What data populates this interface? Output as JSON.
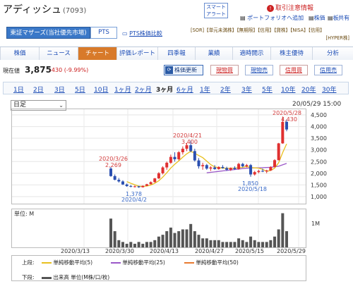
{
  "header": {
    "name": "アディッシュ",
    "code": "(7093)",
    "alert_line1": "スマート",
    "alert_line2": "アラート",
    "sell_note": "取引注意情報",
    "portfolio_add": "ポートフォリオへ追加",
    "stock_price": "株価",
    "board": "板",
    "share": "共有",
    "market": "東証マザーズ(当社優先市場)",
    "pts": "PTS",
    "pts_compare": "PTS株価比較",
    "badges_line1": "[SOR]【単元未満株】【無期限】【信用】【貸株】【NISA】【信用】",
    "badges_line2": "[HYPER株]"
  },
  "tabs": [
    {
      "label": "株価"
    },
    {
      "label": "ニュース"
    },
    {
      "label": "チャート"
    },
    {
      "label": "評価レポート"
    },
    {
      "label": "四季報"
    },
    {
      "label": "業績"
    },
    {
      "label": "適時開示"
    },
    {
      "label": "株主優待"
    },
    {
      "label": "分析"
    }
  ],
  "quote": {
    "label": "現在値",
    "price": "3,875",
    "change": "-430 (-9.99%)",
    "update": "株価更新",
    "buy_spot": "現物買",
    "sell_spot": "現物売",
    "buy_margin": "信用買",
    "sell_margin": "信用売"
  },
  "ranges": [
    "1日",
    "2日",
    "3日",
    "5日",
    "10日",
    "1ヶ月",
    "2ヶ月",
    "3ヶ月",
    "6ヶ月",
    "1年",
    "2年",
    "3年",
    "5年",
    "10年",
    "20年",
    "30年"
  ],
  "selected_range": "3ヶ月",
  "period": {
    "value": "日足"
  },
  "timestamp": "20/05/29 15:00",
  "y_ticks": [
    "4,500",
    "4,000",
    "3,500",
    "3,000",
    "2,500",
    "2,000",
    "1,500",
    "1,000"
  ],
  "volume": {
    "unit": "単位: M",
    "tick": "1M"
  },
  "x_ticks": [
    "2020/3/13",
    "2020/3/30",
    "2020/4/13",
    "2020/4/27",
    "2020/5/15",
    "2020/5/29"
  ],
  "annotations": {
    "a1_date": "2020/3/26",
    "a1_val": "2,269",
    "a2_date": "2020/4/21",
    "a2_val": "3,400",
    "a3_date": "2020/5/28",
    "a3_val": "4,430",
    "b1_val": "1,378",
    "b1_date": "2020/4/2",
    "b2_val": "1,850",
    "b2_date": "2020/5/18"
  },
  "legend": {
    "upper": "上段:",
    "ma5": "単純移動平均(5)",
    "ma25": "単純移動平均(25)",
    "ma50": "単純移動平均(50)",
    "lower": "下段:",
    "vol": "出来高 単位(M株/口/枚)",
    "ma5_color": "#e8c020",
    "ma25_color": "#9b58c8",
    "ma50_color": "#e87a30",
    "vol_color": "#555555"
  },
  "chart_data": [
    {
      "type": "candlestick",
      "ylim": [
        1000,
        4500
      ],
      "x": [
        "2020/3/24",
        "2020/3/25",
        "2020/3/26",
        "2020/3/27",
        "2020/3/30",
        "2020/3/31",
        "2020/4/1",
        "2020/4/2",
        "2020/4/3",
        "2020/4/6",
        "2020/4/7",
        "2020/4/8",
        "2020/4/9",
        "2020/4/10",
        "2020/4/13",
        "2020/4/14",
        "2020/4/15",
        "2020/4/16",
        "2020/4/17",
        "2020/4/20",
        "2020/4/21",
        "2020/4/22",
        "2020/4/23",
        "2020/4/24",
        "2020/4/27",
        "2020/4/28",
        "2020/4/30",
        "2020/5/1",
        "2020/5/7",
        "2020/5/8",
        "2020/5/11",
        "2020/5/12",
        "2020/5/13",
        "2020/5/14",
        "2020/5/15",
        "2020/5/18",
        "2020/5/19",
        "2020/5/20",
        "2020/5/21",
        "2020/5/22",
        "2020/5/25",
        "2020/5/26",
        "2020/5/27",
        "2020/5/28",
        "2020/5/29"
      ],
      "ohlc": [
        [
          2200,
          2269,
          1850,
          1880
        ],
        [
          1880,
          1950,
          1700,
          1720
        ],
        [
          1720,
          1800,
          1600,
          1650
        ],
        [
          1650,
          1700,
          1500,
          1520
        ],
        [
          1520,
          1560,
          1420,
          1450
        ],
        [
          1450,
          1500,
          1400,
          1430
        ],
        [
          1430,
          1480,
          1390,
          1440
        ],
        [
          1440,
          1460,
          1378,
          1400
        ],
        [
          1400,
          1480,
          1390,
          1460
        ],
        [
          1460,
          1550,
          1450,
          1530
        ],
        [
          1530,
          1650,
          1520,
          1620
        ],
        [
          1620,
          1800,
          1600,
          1780
        ],
        [
          1780,
          2050,
          1750,
          2000
        ],
        [
          2000,
          2300,
          1950,
          2250
        ],
        [
          2250,
          2500,
          2150,
          2450
        ],
        [
          2450,
          2800,
          2400,
          2700
        ],
        [
          2700,
          2900,
          2500,
          2600
        ],
        [
          2600,
          2950,
          2550,
          2900
        ],
        [
          2900,
          3150,
          2800,
          3050
        ],
        [
          3050,
          3300,
          2950,
          3200
        ],
        [
          3200,
          3400,
          2900,
          2950
        ],
        [
          2950,
          3050,
          2500,
          2550
        ],
        [
          2550,
          2650,
          2200,
          2300
        ],
        [
          2300,
          2450,
          2150,
          2350
        ],
        [
          2350,
          2400,
          2150,
          2200
        ],
        [
          2200,
          2300,
          2100,
          2250
        ],
        [
          2250,
          2350,
          2150,
          2180
        ],
        [
          2180,
          2300,
          2150,
          2270
        ],
        [
          2270,
          2350,
          2200,
          2220
        ],
        [
          2220,
          2280,
          2100,
          2150
        ],
        [
          2150,
          2250,
          2100,
          2230
        ],
        [
          2230,
          2300,
          2150,
          2180
        ],
        [
          2180,
          2450,
          2150,
          2400
        ],
        [
          2400,
          2450,
          2250,
          2300
        ],
        [
          2300,
          2400,
          2250,
          2350
        ],
        [
          2350,
          2400,
          1850,
          1950
        ],
        [
          1950,
          2100,
          1900,
          2050
        ],
        [
          2050,
          2150,
          2000,
          2100
        ],
        [
          2100,
          2200,
          2050,
          2080
        ],
        [
          2080,
          2150,
          2000,
          2120
        ],
        [
          2120,
          2300,
          2100,
          2270
        ],
        [
          2270,
          2600,
          2250,
          2560
        ],
        [
          2560,
          3300,
          2550,
          3280
        ],
        [
          3280,
          4430,
          3260,
          4200
        ],
        [
          4200,
          4300,
          3800,
          3875
        ]
      ],
      "ma5": [
        null,
        null,
        null,
        null,
        1644,
        1570,
        1510,
        1448,
        1436,
        1452,
        1496,
        1570,
        1678,
        1836,
        2020,
        2226,
        2386,
        2530,
        2690,
        2830,
        2940,
        2860,
        2760,
        2670,
        2520,
        2370,
        2270,
        2240,
        2220,
        2214,
        2210,
        2222,
        2236,
        2256,
        2290,
        2244,
        2230,
        2220,
        2170,
        2080,
        2120,
        2220,
        2450,
        2880,
        3260
      ],
      "ma25": [
        null,
        null,
        null,
        null,
        null,
        null,
        null,
        null,
        null,
        null,
        null,
        null,
        null,
        null,
        null,
        null,
        null,
        null,
        null,
        null,
        null,
        null,
        null,
        null,
        2020,
        2040,
        2060,
        2080,
        2100,
        2120,
        2140,
        2160,
        2180,
        2200,
        2215,
        2225,
        2230,
        2235,
        2240,
        2245,
        2255,
        2275,
        2300,
        2360,
        2420
      ]
    },
    {
      "type": "bar",
      "title": "",
      "ylabel": "出来高",
      "unit": "M",
      "values": [
        1.6,
        0.9,
        0.4,
        0.3,
        0.2,
        0.3,
        0.2,
        0.3,
        0.2,
        0.3,
        0.3,
        0.4,
        0.6,
        0.7,
        0.9,
        1.1,
        0.8,
        0.9,
        1.0,
        1.0,
        1.3,
        0.9,
        0.7,
        0.5,
        0.5,
        0.4,
        0.4,
        0.4,
        0.3,
        0.3,
        0.3,
        0.3,
        0.5,
        0.4,
        0.3,
        0.6,
        0.4,
        0.3,
        0.3,
        0.3,
        0.4,
        0.6,
        1.0,
        1.9,
        0.9
      ]
    }
  ]
}
